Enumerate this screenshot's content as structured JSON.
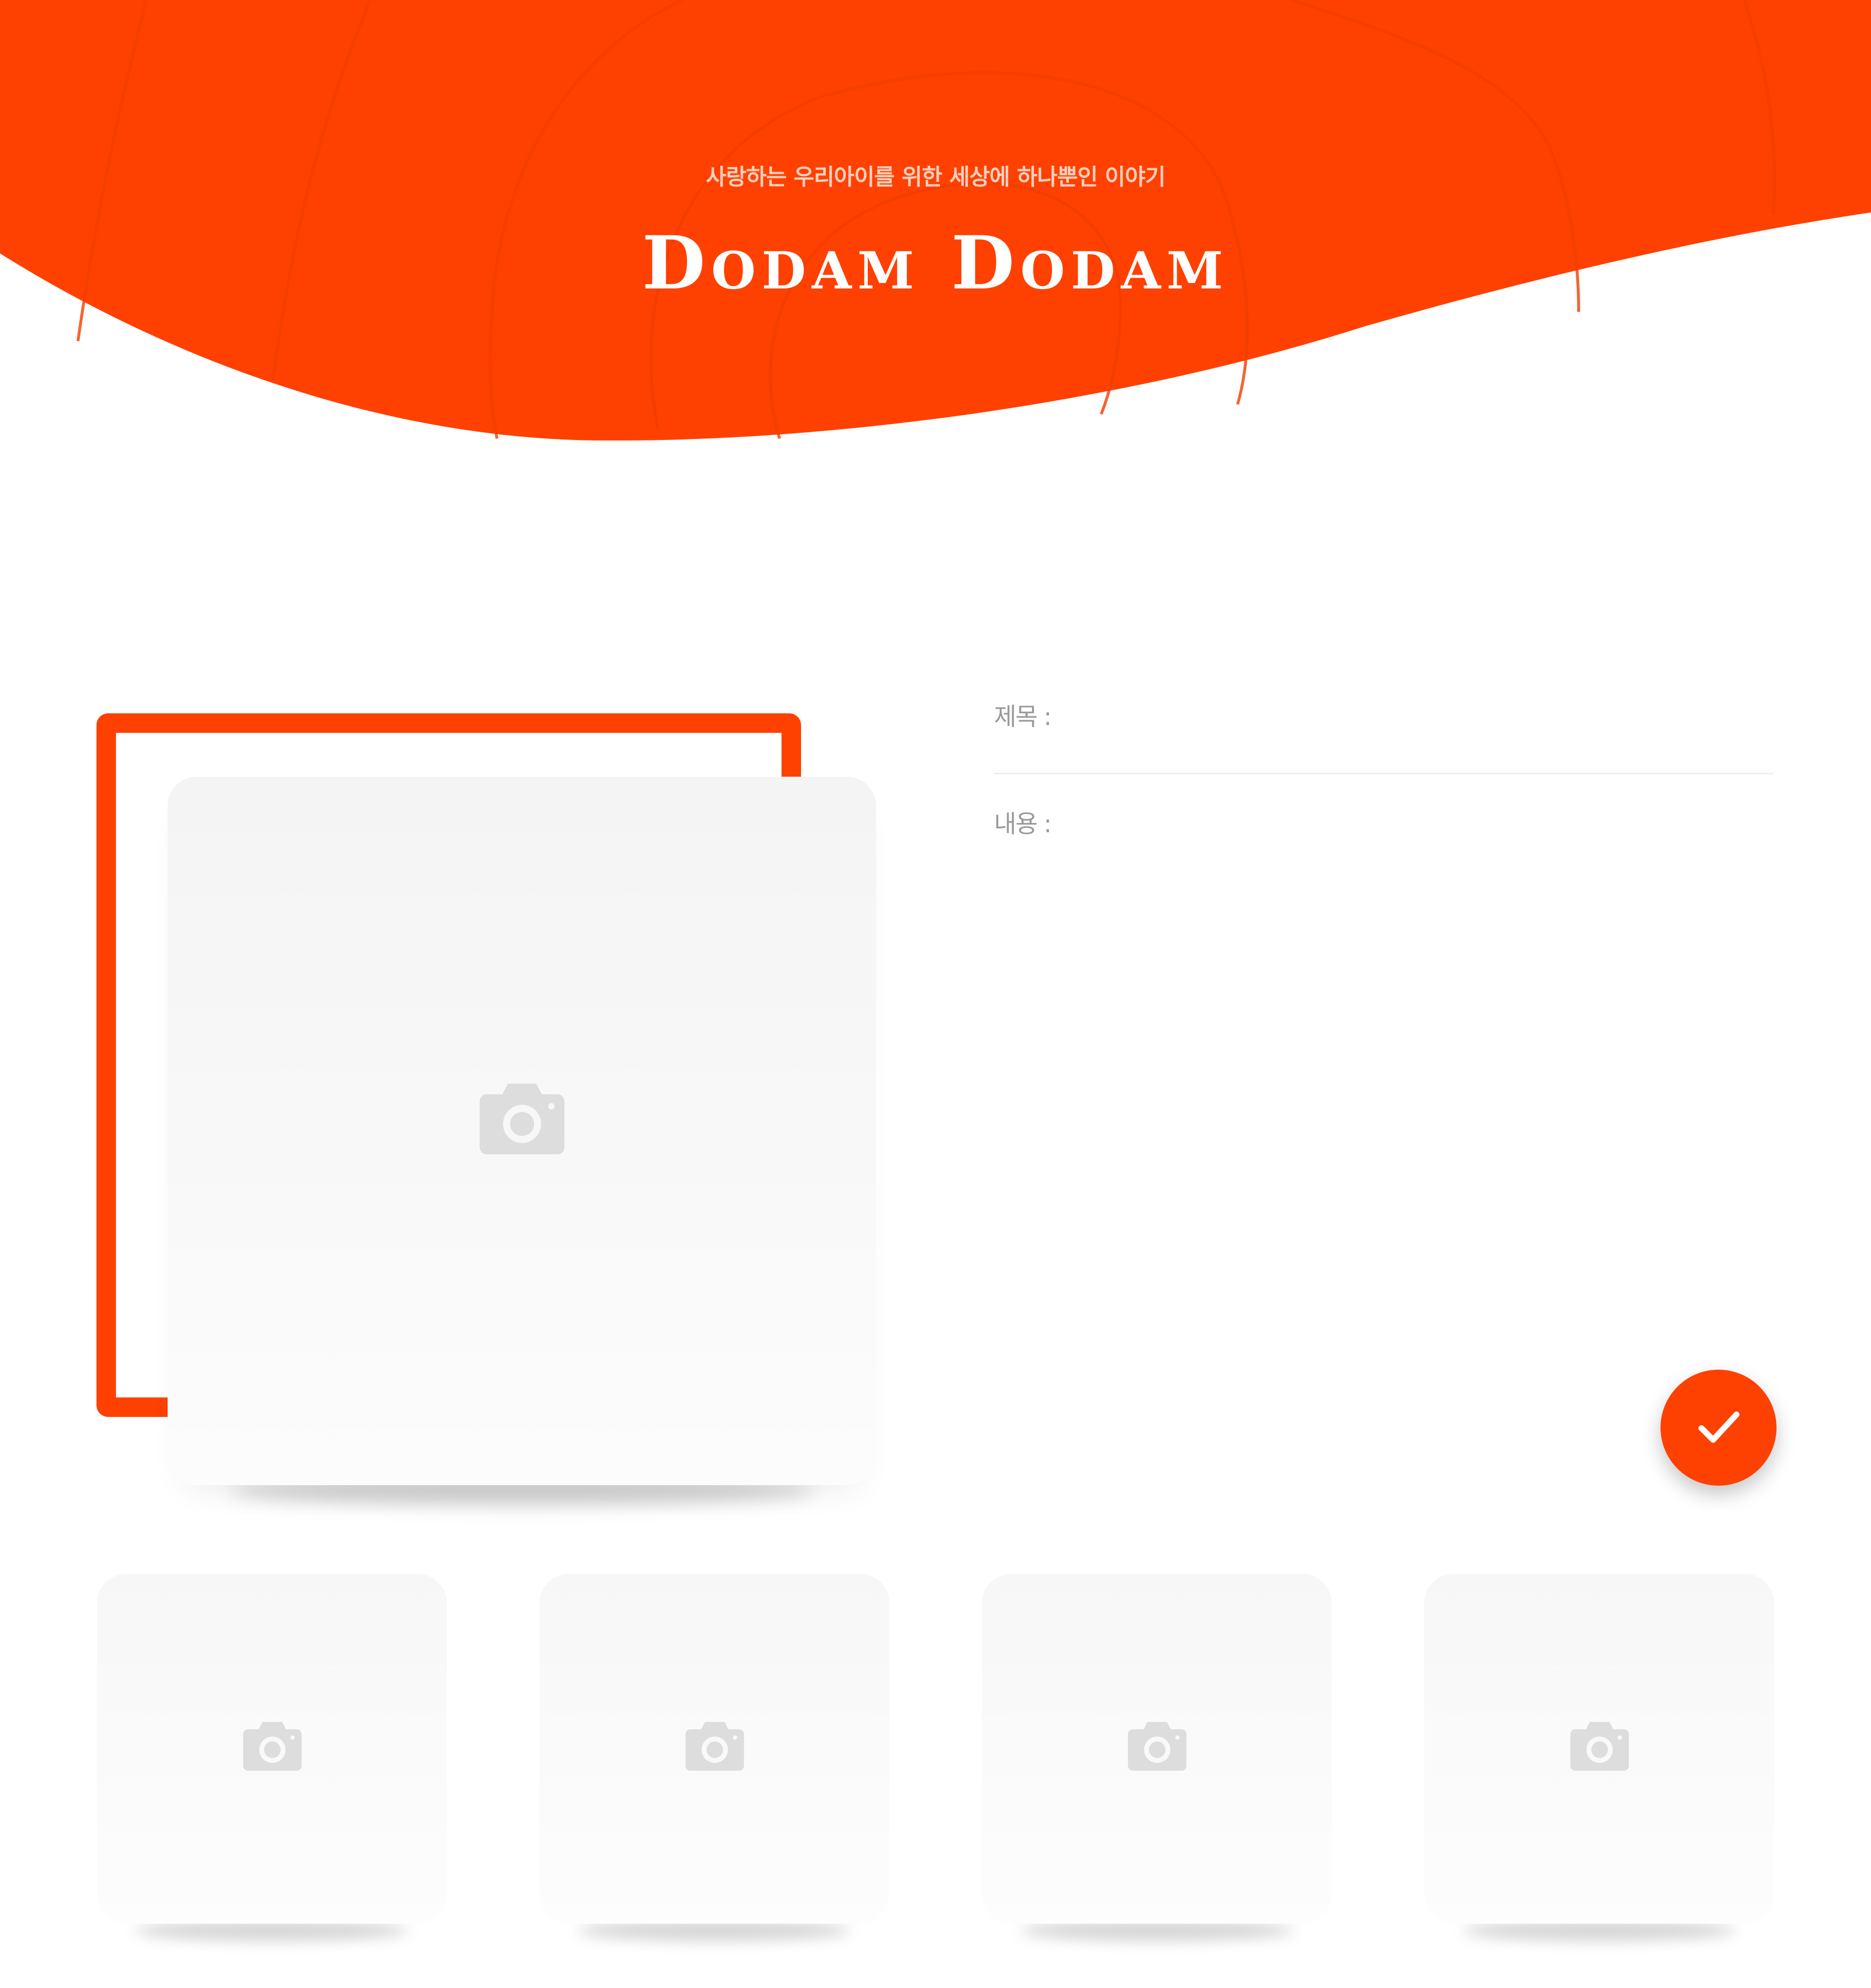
{
  "header": {
    "subtitle": "사랑하는 우리아이를 위한 세상에 하나뿐인 이야기",
    "title": "Dodam Dodam"
  },
  "colors": {
    "accent": "#fe4100",
    "placeholder_bg": "#f5f5f5",
    "icon_gray": "#dddddd",
    "label_gray": "#9a9a9a"
  },
  "photo": {
    "main_icon": "camera-icon",
    "thumbnail_icons": [
      "camera-icon",
      "camera-icon",
      "camera-icon",
      "camera-icon"
    ]
  },
  "form": {
    "title_label": "제목 :",
    "title_value": "",
    "content_label": "내용 :",
    "content_value": ""
  },
  "actions": {
    "confirm_icon": "check-icon"
  }
}
